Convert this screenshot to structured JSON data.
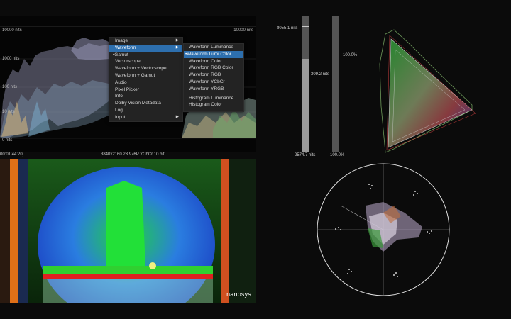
{
  "waveform": {
    "top_left_nits": "10000 nits",
    "top_right_nits": "10000 nits",
    "label_1000": "1000 nits",
    "label_100": "100 nits",
    "label_10": "10 nits",
    "label_0": "0 nits",
    "timecode": "00:01:44:20]",
    "format": "3840x2160 23.976P YCbCr 10 bit"
  },
  "menu": {
    "items": [
      {
        "label": "Image",
        "arrow": "▶"
      },
      {
        "label": "Waveform",
        "arrow": "▶"
      },
      {
        "label": "•Gamut",
        "arrow": ""
      },
      {
        "label": "Vectorscope",
        "arrow": ""
      },
      {
        "label": "Waveform + Vectorscope",
        "arrow": ""
      },
      {
        "label": "Waveform + Gamut",
        "arrow": ""
      },
      {
        "label": "Audio",
        "arrow": ""
      },
      {
        "label": "Pixel Picker",
        "arrow": ""
      },
      {
        "label": "Info",
        "arrow": ""
      },
      {
        "label": "Dolby Vision Metadata",
        "arrow": ""
      },
      {
        "label": "Log",
        "arrow": ""
      },
      {
        "label": "Input",
        "arrow": "▶"
      }
    ]
  },
  "submenu": {
    "items": [
      "Waveform Luminance",
      "•Waveform Lumi Color",
      "Waveform Color",
      "Waveform RGB Color",
      "Waveform RGB",
      "Waveform YCbCr",
      "Waveform YRGB",
      "Histogram Luminance",
      "Histogram Color"
    ]
  },
  "meters": {
    "max_nits": "8055.1 nits",
    "avg_nits": "309.2 nits",
    "min_nits": "2574.7 nits",
    "pct_top": "100.0%",
    "pct_bottom": "100.0%",
    "left_fill": 0.68,
    "right_fill": 0.0
  },
  "image": {
    "logo_text": "nanosys"
  },
  "colors": {
    "highlight": "#2d6fae",
    "menu_bg": "#232323"
  }
}
